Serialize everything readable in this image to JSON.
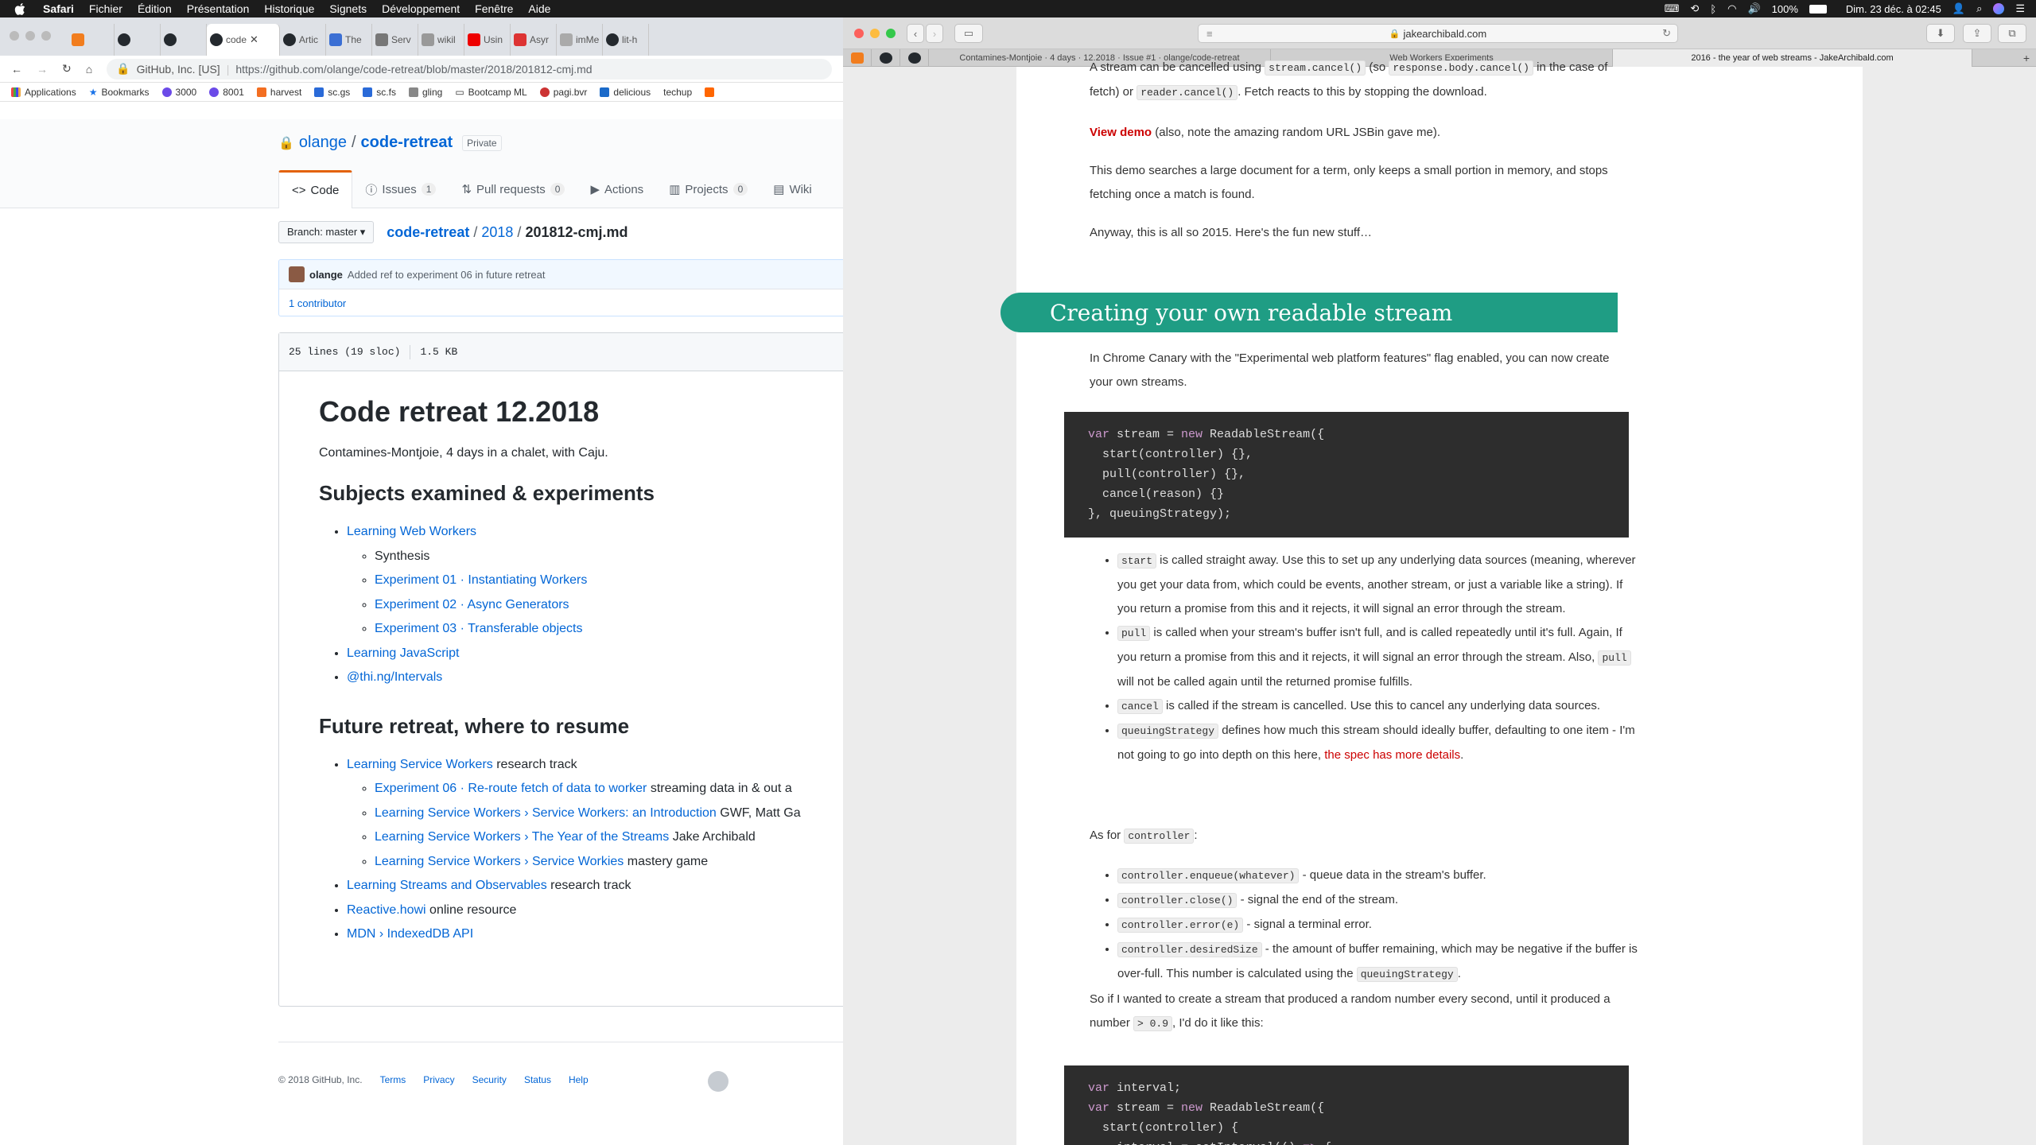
{
  "menubar": {
    "items": [
      "Safari",
      "Fichier",
      "Édition",
      "Présentation",
      "Historique",
      "Signets",
      "Développement",
      "Fenêtre",
      "Aide"
    ],
    "battery": "100%",
    "datetime": "Dim. 23 déc. à 02:45"
  },
  "chrome": {
    "tabs": [
      {
        "label": "",
        "icon": "h"
      },
      {
        "label": "",
        "icon": "gh"
      },
      {
        "label": "",
        "icon": "gh"
      },
      {
        "label": "code",
        "icon": "gh",
        "active": true
      },
      {
        "label": "Artic",
        "icon": "gh"
      },
      {
        "label": "The",
        "icon": "doc"
      },
      {
        "label": "Serv",
        "icon": "code"
      },
      {
        "label": "wikil",
        "icon": "doc"
      },
      {
        "label": "Usin",
        "icon": "yt"
      },
      {
        "label": "Asyr",
        "icon": "x"
      },
      {
        "label": "imMe",
        "icon": "doc"
      },
      {
        "label": "lit-h",
        "icon": "gh"
      }
    ],
    "address": {
      "org": "GitHub, Inc. [US]",
      "url": "https://github.com/olange/code-retreat/blob/master/2018/201812-cmj.md"
    },
    "bookmarks": [
      "Applications",
      "Bookmarks",
      "3000",
      "8001",
      "harvest",
      "sc.gs",
      "sc.fs",
      "gling",
      "Bootcamp ML",
      "pagi.bvr",
      "delicious",
      "techup"
    ]
  },
  "github": {
    "owner": "olange",
    "repo": "code-retreat",
    "private_label": "Private",
    "nav": [
      {
        "label": "Code",
        "count": ""
      },
      {
        "label": "Issues",
        "count": "1"
      },
      {
        "label": "Pull requests",
        "count": "0"
      },
      {
        "label": "Actions",
        "count": ""
      },
      {
        "label": "Projects",
        "count": "0"
      },
      {
        "label": "Wiki",
        "count": ""
      }
    ],
    "branch": "Branch: master ▾",
    "breadcrumb": {
      "repo": "code-retreat",
      "dir": "2018",
      "file": "201812-cmj.md"
    },
    "commit": {
      "author": "olange",
      "message": "Added ref to experiment 06 in future retreat",
      "contributors": "1 contributor"
    },
    "file_meta": {
      "lines": "25 lines (19 sloc)",
      "size": "1.5 KB"
    },
    "md": {
      "title": "Code retreat 12.2018",
      "intro": "Contamines-Montjoie, 4 days in a chalet, with Caju.",
      "h2a": "Subjects examined & experiments",
      "list1": {
        "web_workers": "Learning Web Workers",
        "synthesis": "Synthesis",
        "exp01": "Experiment 01 · Instantiating Workers",
        "exp02": "Experiment 02 · Async Generators",
        "exp03": "Experiment 03 · Transferable objects",
        "js": "Learning JavaScript",
        "intervals": "@thi.ng/Intervals"
      },
      "h2b": "Future retreat, where to resume",
      "list2": {
        "sw": "Learning Service Workers",
        "sw_rest": " research track",
        "exp06": "Experiment 06 · Re-route fetch of data to worker",
        "exp06_rest": " streaming data in & out a",
        "sw_intro": "Learning Service Workers › Service Workers: an Introduction",
        "sw_intro_rest": " GWF, Matt Ga",
        "sw_streams": "Learning Service Workers › The Year of the Streams",
        "sw_streams_rest": " Jake Archibald",
        "sw_workies": "Learning Service Workers › Service Workies",
        "sw_workies_rest": " mastery game",
        "streams": "Learning Streams and Observables",
        "streams_rest": " research track",
        "reactive": "Reactive.howi",
        "reactive_rest": " online resource",
        "mdn": "MDN › IndexedDB API"
      }
    },
    "footer": [
      "© 2018 GitHub, Inc.",
      "Terms",
      "Privacy",
      "Security",
      "Status",
      "Help"
    ]
  },
  "safari": {
    "url": "jakearchibald.com",
    "tabs": [
      "Contamines-Montjoie · 4 days · 12.2018 · Issue #1 · olange/code-retreat",
      "Web Workers Experiments",
      "2016 - the year of web streams - JakeArchibald.com"
    ],
    "article": {
      "p0a": "A stream can be cancelled using ",
      "p0b": " (so ",
      "p0c": " in the case of fetch) or ",
      "p0d": ". Fetch reacts to this by stopping the download.",
      "code_cancel": "stream.cancel()",
      "code_body": "response.body.cancel()",
      "code_reader": "reader.cancel()",
      "view_demo": "View demo",
      "p1": " (also, note the amazing random URL JSBin gave me).",
      "p2": "This demo searches a large document for a term, only keeps a small portion in memory, and stops fetching once a match is found.",
      "p3": "Anyway, this is all so 2015. Here's the fun new stuff…",
      "heading": "Creating your own readable stream",
      "p4": "In Chrome Canary with the \"Experimental web platform features\" flag enabled, you can now create your own streams.",
      "b1_code": "start",
      "b1": " is called straight away. Use this to set up any underlying data sources (meaning, wherever you get your data from, which could be events, another stream, or just a variable like a string). If you return a promise from this and it rejects, it will signal an error through the stream.",
      "b2_code": "pull",
      "b2a": " is called when your stream's buffer isn't full, and is called repeatedly until it's full. Again, If you return a promise from this and it rejects, it will signal an error through the stream. Also, ",
      "b2b": " will not be called again until the returned promise fulfills.",
      "b3_code": "cancel",
      "b3": " is called if the stream is cancelled. Use this to cancel any underlying data sources.",
      "b4_code": "queuingStrategy",
      "b4": " defines how much this stream should ideally buffer, defaulting to one item - I'm not going to go into depth on this here, ",
      "b4_link": "the spec has more details",
      "p5a": "As for ",
      "p5_code": "controller",
      "c1_code": "controller.enqueue(whatever)",
      "c1": " - queue data in the stream's buffer.",
      "c2_code": "controller.close()",
      "c2": " - signal the end of the stream.",
      "c3_code": "controller.error(e)",
      "c3": " - signal a terminal error.",
      "c4_code": "controller.desiredSize",
      "c4a": " - the amount of buffer remaining, which may be negative if the buffer is over-full. This number is calculated using the ",
      "c4_code2": "queuingStrategy",
      "p6a": "So if I wanted to create a stream that produced a random number every second, until it produced a number ",
      "p6_code": "> 0.9",
      "p6b": ", I'd do it like this:"
    }
  }
}
